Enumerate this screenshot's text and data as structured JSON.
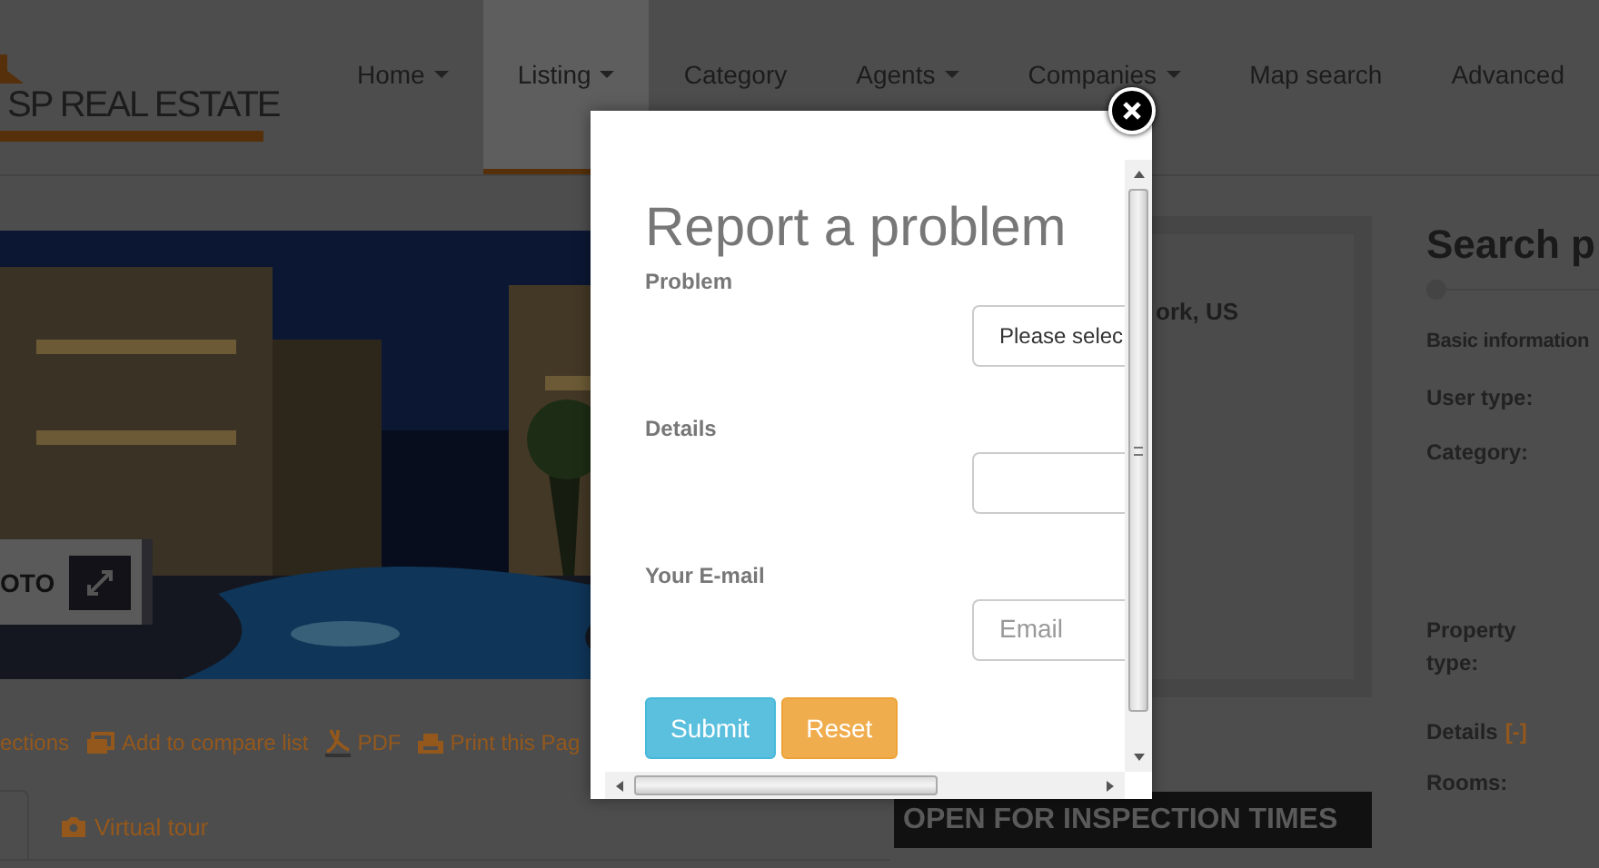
{
  "header": {
    "logo": "SP REAL ESTATE",
    "nav": [
      {
        "label": "Home",
        "dropdown": true,
        "selected": false
      },
      {
        "label": "Listing",
        "dropdown": true,
        "selected": true
      },
      {
        "label": "Category",
        "dropdown": false,
        "selected": false
      },
      {
        "label": "Agents",
        "dropdown": true,
        "selected": false
      },
      {
        "label": "Companies",
        "dropdown": true,
        "selected": false
      },
      {
        "label": "Map search",
        "dropdown": false,
        "selected": false
      },
      {
        "label": "Advanced",
        "dropdown": false,
        "selected": false
      }
    ]
  },
  "photo": {
    "label": "OTO"
  },
  "actions": [
    {
      "label": "ections"
    },
    {
      "label": "Add to compare list"
    },
    {
      "label": "PDF"
    },
    {
      "label": "Print this Pag"
    }
  ],
  "tabs": [
    {
      "label": "Virtual tour"
    }
  ],
  "property": {
    "location": "ork, US",
    "inspection_title": "OPEN FOR INSPECTION TIMES"
  },
  "search": {
    "title": "Search p",
    "section": "Basic information",
    "fields": [
      "User type:",
      "Category:",
      "Property type:"
    ],
    "details": "Details",
    "toggle": "[-]",
    "rooms": "Rooms:"
  },
  "modal": {
    "title": "Report a problem",
    "fields": [
      {
        "label": "Problem",
        "kind": "select",
        "value": "Please selec"
      },
      {
        "label": "Details",
        "kind": "text"
      },
      {
        "label": "Your E-mail",
        "kind": "text",
        "placeholder": "Email"
      }
    ],
    "buttons": [
      {
        "label": "Submit",
        "kind": "primary"
      },
      {
        "label": "Reset",
        "kind": "warning"
      }
    ]
  }
}
